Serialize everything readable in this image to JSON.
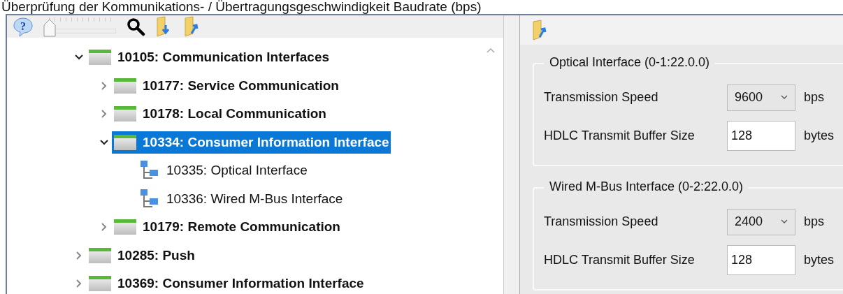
{
  "caption": "Überprüfung der Kommunikations- / Übertragungsgeschwindigkeit Baudrate (bps)",
  "left_toolbar": {
    "help_glyph": "?",
    "zoom_slider": {
      "level": 0.0
    }
  },
  "tree": [
    {
      "label": "10105: Communication Interfaces",
      "kind": "group",
      "expanded": true,
      "selected": false,
      "children": [
        {
          "label": "10177: Service Communication",
          "kind": "group",
          "expanded": false,
          "selected": false
        },
        {
          "label": "10178: Local Communication",
          "kind": "group",
          "expanded": false,
          "selected": false
        },
        {
          "label": "10334: Consumer Information Interface",
          "kind": "group",
          "expanded": true,
          "selected": true,
          "children": [
            {
              "label": "10335: Optical Interface",
              "kind": "interface",
              "selected": false
            },
            {
              "label": "10336: Wired M-Bus Interface",
              "kind": "interface",
              "selected": false
            }
          ]
        },
        {
          "label": "10179: Remote Communication",
          "kind": "group",
          "expanded": false,
          "selected": false
        }
      ]
    },
    {
      "label": "10285: Push",
      "kind": "group",
      "expanded": false,
      "selected": false
    },
    {
      "label": "10369: Consumer Information Interface",
      "kind": "group",
      "expanded": false,
      "selected": false
    }
  ],
  "groups": [
    {
      "title": "Optical Interface (0-1:22.0.0)",
      "fields": [
        {
          "label": "Transmission Speed",
          "kind": "dropdown",
          "value": "9600",
          "unit": "bps"
        },
        {
          "label": "HDLC Transmit Buffer Size",
          "kind": "text",
          "value": "128",
          "unit": "bytes"
        }
      ]
    },
    {
      "title": "Wired M-Bus Interface (0-2:22.0.0)",
      "fields": [
        {
          "label": "Transmission Speed",
          "kind": "dropdown",
          "value": "2400",
          "unit": "bps"
        },
        {
          "label": "HDLC Transmit Buffer Size",
          "kind": "text",
          "value": "128",
          "unit": "bytes"
        }
      ]
    }
  ]
}
